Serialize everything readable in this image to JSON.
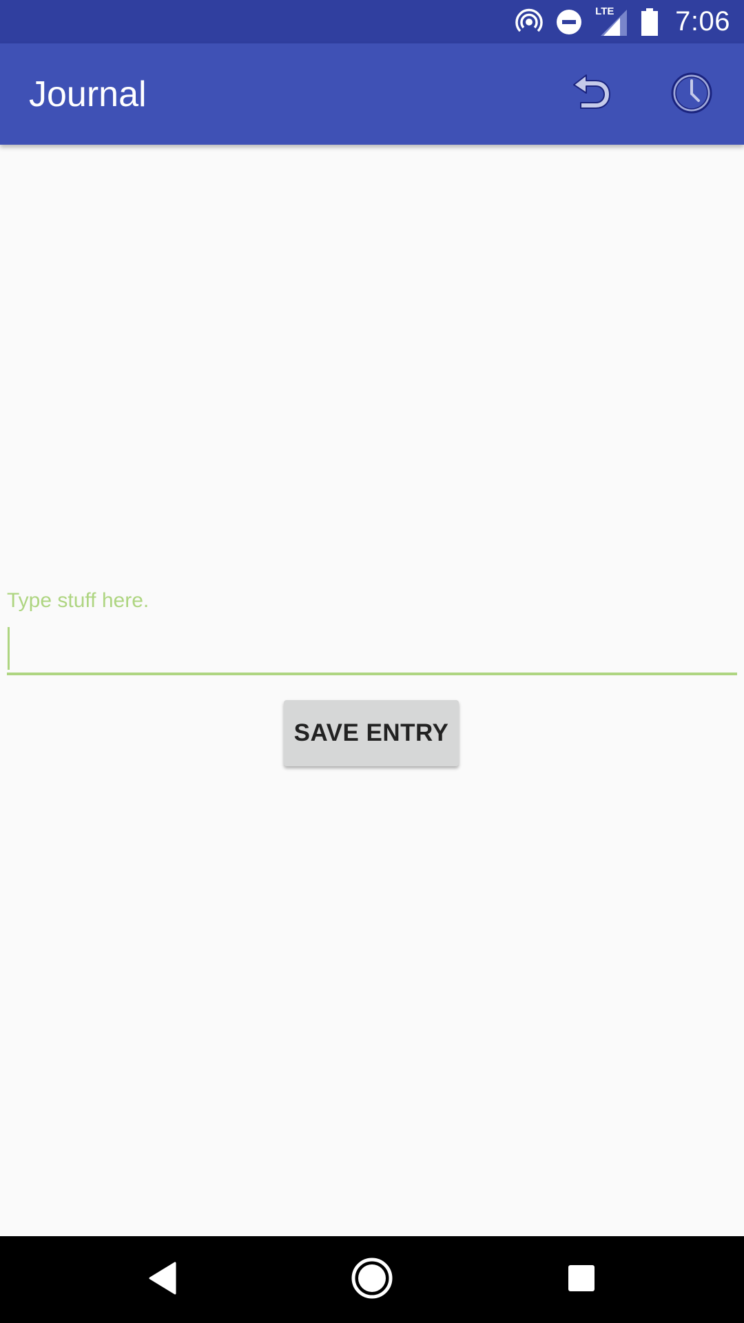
{
  "status_bar": {
    "time": "7:06",
    "network_label": "LTE",
    "icons": [
      "hotspot-icon",
      "do-not-disturb-icon",
      "signal-icon",
      "battery-icon"
    ]
  },
  "app_bar": {
    "title": "Journal",
    "actions": [
      "undo-icon",
      "history-icon"
    ],
    "background": "#3f51b5",
    "status_background": "#303f9f"
  },
  "editor": {
    "hint_label": "Type stuff here.",
    "input_value": "",
    "accent_color": "#aed581"
  },
  "save_button": {
    "label": "SAVE ENTRY"
  },
  "nav_bar": {
    "buttons": [
      "back-icon",
      "home-icon",
      "recents-icon"
    ]
  }
}
